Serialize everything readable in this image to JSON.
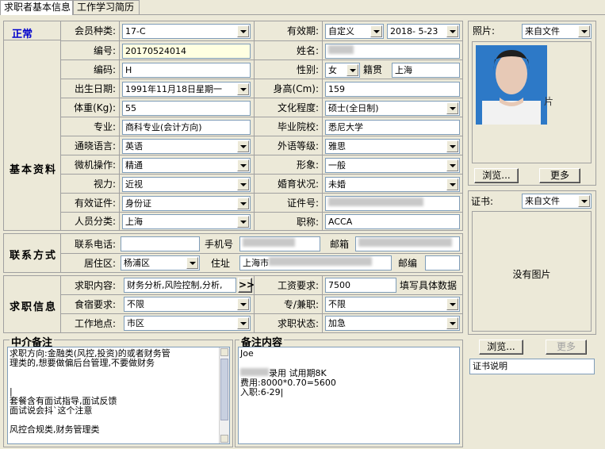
{
  "tabs": [
    "求职者基本信息",
    "工作学习简历"
  ],
  "status": "正常",
  "sections": {
    "basic": "基本资料",
    "contact": "联系方式",
    "job": "求职信息",
    "agent_notes": "中介备注",
    "notes": "备注内容"
  },
  "basic": {
    "member_type_label": "会员种类:",
    "member_type": "17-C",
    "validity_label": "有效期:",
    "validity_mode": "自定义",
    "validity_date": "2018- 5-23",
    "number_label": "编号:",
    "number": "20170524014",
    "name_label": "姓名:",
    "code_label": "编码:",
    "code": "H",
    "gender_label": "性别:",
    "gender": "女",
    "native_label": "籍贯",
    "native": "上海",
    "birth_label": "出生日期:",
    "birth": "1991年11月18日星期一",
    "height_label": "身高(Cm):",
    "height": "159",
    "weight_label": "体重(Kg):",
    "weight": "55",
    "education_label": "文化程度:",
    "education": "硕士(全日制)",
    "major_label": "专业:",
    "major": "商科专业(会计方向)",
    "school_label": "毕业院校:",
    "school": "悉尼大学",
    "language_label": "通晓语言:",
    "language": "英语",
    "lang_level_label": "外语等级:",
    "lang_level": "雅思",
    "computer_label": "微机操作:",
    "computer": "精通",
    "appearance_label": "形象:",
    "appearance": "一般",
    "vision_label": "视力:",
    "vision": "近视",
    "marital_label": "婚育状况:",
    "marital": "未婚",
    "id_type_label": "有效证件:",
    "id_type": "身份证",
    "id_no_label": "证件号:",
    "category_label": "人员分类:",
    "category": "上海",
    "title_label": "职称:",
    "title": "ACCA"
  },
  "contact": {
    "phone_label": "联系电话:",
    "mobile_label": "手机号",
    "email_label": "邮箱",
    "district_label": "居住区:",
    "district": "杨浦区",
    "address_label": "住址",
    "address_prefix": "上海市",
    "zip_label": "邮编"
  },
  "job": {
    "intent_label": "求职内容:",
    "intent": "财务分析,风险控制,分析,",
    "salary_label": "工资要求:",
    "salary": "7500",
    "salary_hint": "填写具体数据",
    "board_label": "食宿要求:",
    "board": "不限",
    "fulltime_label": "专/兼职:",
    "fulltime": "不限",
    "location_label": "工作地点:",
    "location": "市区",
    "job_status_label": "求职状态:",
    "job_status": "加急"
  },
  "agent_notes": [
    "求职方向:金融类(风控,投资)的或者财务管",
    "理类的,想要做偏后台管理,不要做财务",
    "",
    "",
    "|",
    "套餐含有面试指导,面试反馈",
    "面试说会抖`这个注意",
    "",
    "风控合规类,财务管理类"
  ],
  "notes": [
    "Joe",
    "",
    "录用 试用期8K",
    "费用:8000*0.70=5600",
    "入职:6-29|"
  ],
  "photo": {
    "label": "照片:",
    "source": "来自文件",
    "browse": "浏览...",
    "more": "更多"
  },
  "certificate": {
    "label": "证书:",
    "source": "来自文件",
    "empty": "没有图片",
    "browse": "浏览...",
    "more": "更多",
    "desc": "证书说明"
  }
}
